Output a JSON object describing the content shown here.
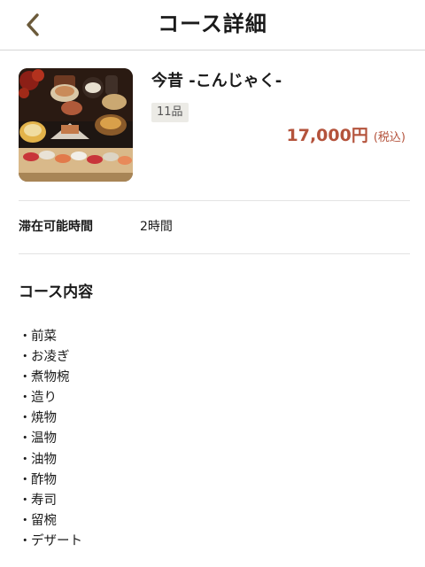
{
  "header": {
    "title": "コース詳細",
    "back_icon": "chevron-left-icon",
    "back_color": "#6b5a3a"
  },
  "course": {
    "name": "今昔 -こんじゃく-",
    "item_count": "11品",
    "price": "17,000円",
    "tax_note": "(税込)",
    "price_color": "#b4533c"
  },
  "stay": {
    "label": "滞在可能時間",
    "value": "2時間"
  },
  "contents": {
    "title": "コース内容",
    "bullet": "・",
    "items": [
      "前菜",
      "お凌ぎ",
      "煮物椀",
      "造り",
      "焼物",
      "温物",
      "油物",
      "酢物",
      "寿司",
      "留椀",
      "デザート"
    ]
  }
}
